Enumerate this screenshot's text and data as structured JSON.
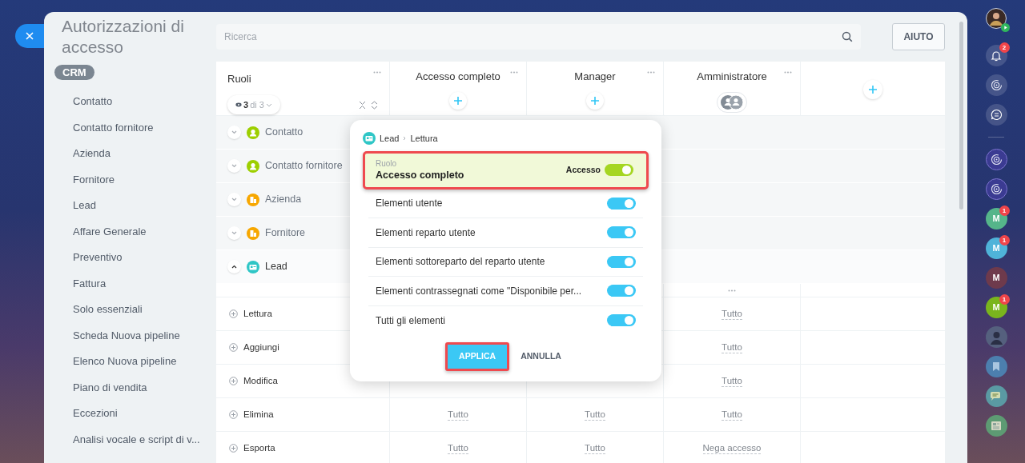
{
  "title": "Autorizzazioni di accesso",
  "nav": {
    "group": "CRM",
    "items": [
      {
        "label": "Contatto"
      },
      {
        "label": "Contatto fornitore"
      },
      {
        "label": "Azienda"
      },
      {
        "label": "Fornitore"
      },
      {
        "label": "Lead"
      },
      {
        "label": "Affare Generale"
      },
      {
        "label": "Preventivo"
      },
      {
        "label": "Fattura"
      },
      {
        "label": "Solo essenziali"
      },
      {
        "label": "Scheda Nuova pipeline"
      },
      {
        "label": "Elenco Nuova pipeline"
      },
      {
        "label": "Piano di vendita"
      },
      {
        "label": "Eccezioni"
      },
      {
        "label": "Analisi vocale e script di v..."
      }
    ]
  },
  "search": {
    "placeholder": "Ricerca"
  },
  "help_button": "AIUTO",
  "table": {
    "first_column": {
      "title": "Ruoli",
      "shown": "3",
      "total": "di 3"
    },
    "roles": [
      {
        "title": "Accesso completo",
        "kind": "add"
      },
      {
        "title": "Manager",
        "kind": "add"
      },
      {
        "title": "Amministratore",
        "kind": "users"
      }
    ],
    "entities": [
      {
        "name": "Contatto",
        "kind": "person",
        "color": "#9dcf00",
        "expanded": false
      },
      {
        "name": "Contatto fornitore",
        "kind": "person",
        "color": "#9dcf00",
        "expanded": false
      },
      {
        "name": "Azienda",
        "kind": "company",
        "color": "#f7a700",
        "expanded": false
      },
      {
        "name": "Fornitore",
        "kind": "company",
        "color": "#f7a700",
        "expanded": false
      },
      {
        "name": "Lead",
        "kind": "card",
        "color": "#2fc6c6",
        "expanded": true
      }
    ],
    "permissions": [
      {
        "name": "Lettura",
        "amministratore": "Tutto"
      },
      {
        "name": "Aggiungi",
        "amministratore": "Tutto"
      },
      {
        "name": "Modifica",
        "amministratore": "Tutto"
      },
      {
        "name": "Elimina",
        "accesso_completo": "Tutto",
        "manager": "Tutto",
        "amministratore": "Tutto"
      },
      {
        "name": "Esporta",
        "accesso_completo": "Tutto",
        "manager": "Tutto",
        "amministratore": "Nega accesso"
      }
    ]
  },
  "popover": {
    "breadcrumb": [
      "Lead",
      "Lettura"
    ],
    "role": {
      "label": "Ruolo",
      "name": "Accesso completo",
      "toggle_label": "Accesso",
      "on": true,
      "highlighted": true
    },
    "options": [
      {
        "label": "Elementi utente",
        "on": true
      },
      {
        "label": "Elementi reparto utente",
        "on": true
      },
      {
        "label": "Elementi sottoreparto del reparto utente",
        "on": true
      },
      {
        "label": "Elementi contrassegnati come \"Disponibile per...",
        "on": true
      },
      {
        "label": "Tutti gli elementi",
        "on": true
      }
    ],
    "apply": {
      "label": "APPLICA",
      "highlighted": true
    },
    "cancel": "ANNULLA"
  },
  "right_bar": [
    {
      "kind": "avatar"
    },
    {
      "kind": "bell",
      "badge": "2"
    },
    {
      "kind": "swirl"
    },
    {
      "kind": "chat"
    },
    {
      "kind": "divider"
    },
    {
      "kind": "ring"
    },
    {
      "kind": "ring"
    },
    {
      "kind": "letter",
      "letter": "M",
      "color": "#55b58a",
      "badge": "1"
    },
    {
      "kind": "letter",
      "letter": "M",
      "color": "#4fb3d9",
      "badge": "1"
    },
    {
      "kind": "letter",
      "letter": "M",
      "color": "#6e3a4c"
    },
    {
      "kind": "letter",
      "letter": "M",
      "color": "#7ab51d",
      "badge": "1"
    },
    {
      "kind": "photo"
    },
    {
      "kind": "bookmark"
    },
    {
      "kind": "messages"
    },
    {
      "kind": "news"
    }
  ]
}
